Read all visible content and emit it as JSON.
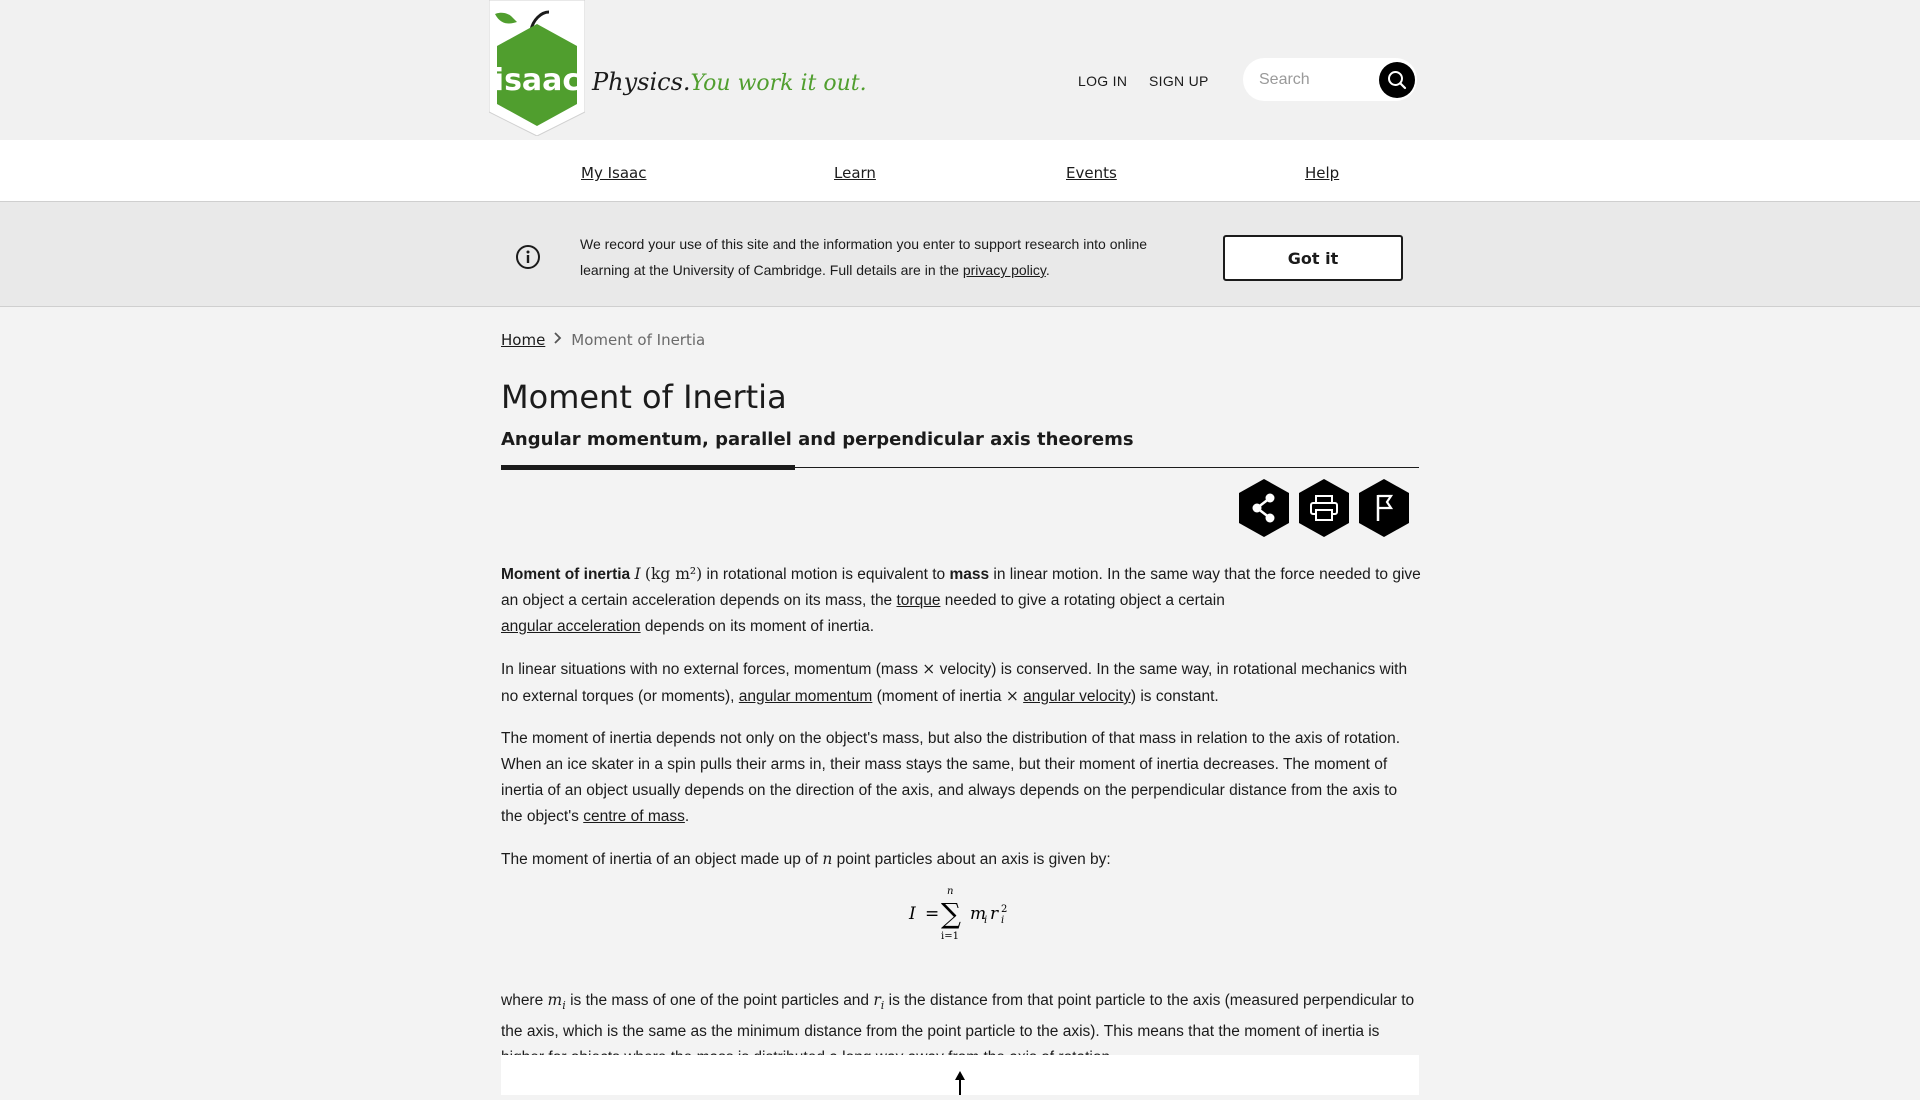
{
  "header": {
    "logo_text": "isaac",
    "tagline_main": "Physics.",
    "tagline_accent": "You work it out.",
    "login_label": "LOG IN",
    "signup_label": "SIGN UP",
    "search_placeholder": "Search",
    "brand_green": "#509e2e"
  },
  "nav": {
    "items": [
      {
        "label": "My Isaac"
      },
      {
        "label": "Learn"
      },
      {
        "label": "Events"
      },
      {
        "label": "Help"
      }
    ]
  },
  "banner": {
    "text_before": "We record your use of this site and the information you enter to support research into online learning at the University of Cambridge. Full details are in the ",
    "link_text": "privacy policy",
    "text_after": ".",
    "button_label": "Got it"
  },
  "breadcrumb": {
    "home": "Home",
    "current": "Moment of Inertia"
  },
  "page": {
    "title": "Moment of Inertia",
    "subtitle": "Angular momentum, parallel and perpendicular axis theorems"
  },
  "actions": {
    "icons": [
      "share-icon",
      "print-icon",
      "flag-icon"
    ]
  },
  "content": {
    "p1": {
      "bold1": "Moment of inertia",
      "sym_I": "I",
      "units": "(kg m²)",
      "t1": " in rotational motion is equivalent to ",
      "bold2": "mass",
      "t2": " in linear motion. In the same way that the force needed to give an object a certain acceleration depends on its mass, the ",
      "link1": "torque",
      "t3": " needed to give a rotating object a certain ",
      "link2": "angular acceleration",
      "t4": " depends on its moment of inertia."
    },
    "p2": {
      "t1": "In linear situations with no external forces, momentum (mass ",
      "times1": "×",
      "t2": " velocity) is conserved. In the same way, in rotational mechanics with no external torques (or moments), ",
      "link1": "angular momentum",
      "t3": " (moment of inertia ",
      "times2": "×",
      "t4": " ",
      "link2": "angular velocity",
      "t5": ") is constant."
    },
    "p3": {
      "t1": "The moment of inertia depends not only on the object's mass, but also the distribution of that mass in relation to the axis of rotation. When an ice skater in a spin pulls their arms in, their mass stays the same, but their moment of inertia decreases. The moment of inertia of an object usually depends on the direction of the axis, and always depends on the perpendicular distance from the axis to the object's ",
      "link1": "centre of mass",
      "t2": "."
    },
    "p4": {
      "t1": "The moment of inertia of an object made up of ",
      "sym_n": "n",
      "t2": " point particles about an axis is given by:"
    },
    "equation": {
      "lhs": "I",
      "eq": "=",
      "sigma": "∑",
      "upper": "n",
      "lower": "i=1",
      "m": "m",
      "sub_i": "i",
      "r": "r",
      "sup_2": "2"
    },
    "p5": {
      "t1": "where ",
      "sym_m": "m",
      "sub_i": "i",
      "t2": " is the mass of one of the point particles and ",
      "sym_r": "r",
      "t3": " is the distance from that point particle to the axis (measured perpendicular to the axis, which is the same as the minimum distance from the point particle to the axis). This means that the moment of inertia is higher for objects where the mass is distributed a long way away from the axis of rotation."
    }
  }
}
